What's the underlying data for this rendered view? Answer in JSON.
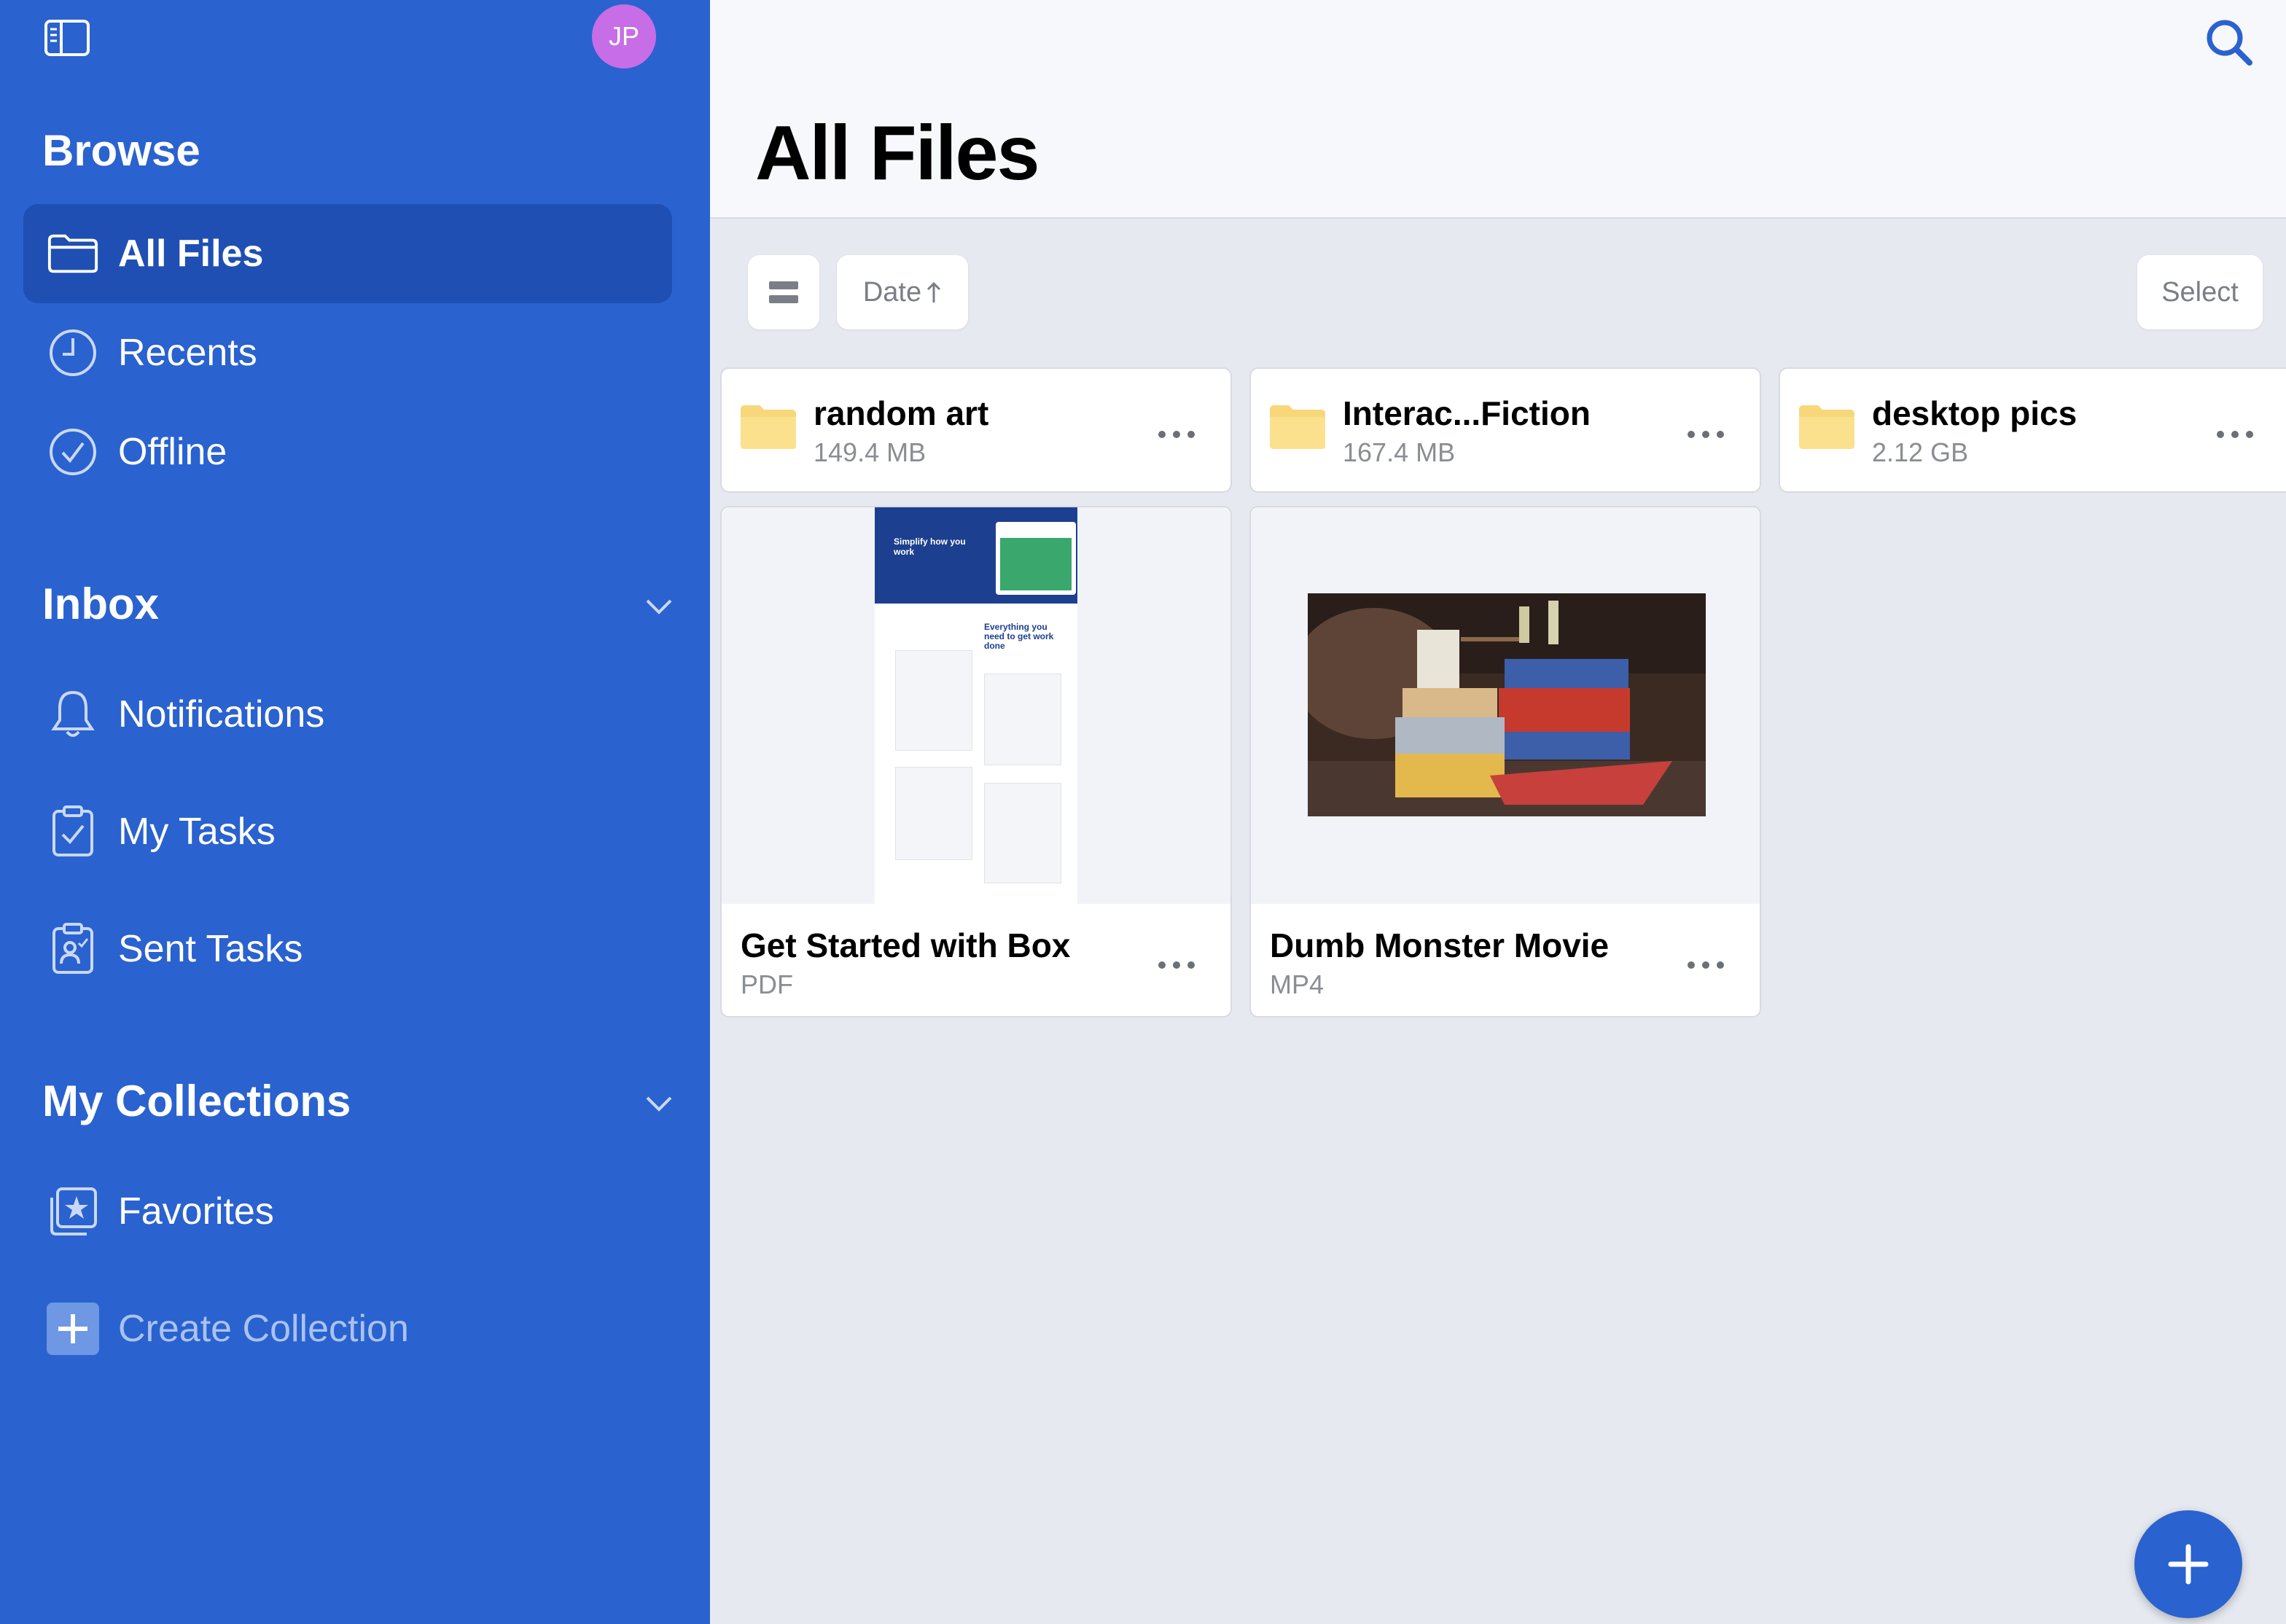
{
  "sidebar": {
    "avatar_initials": "JP",
    "browse": {
      "title": "Browse",
      "items": [
        {
          "label": "All Files",
          "icon": "folder-icon",
          "active": true
        },
        {
          "label": "Recents",
          "icon": "clock-icon"
        },
        {
          "label": "Offline",
          "icon": "check-circle-icon"
        }
      ]
    },
    "inbox": {
      "title": "Inbox",
      "items": [
        {
          "label": "Notifications",
          "icon": "bell-icon"
        },
        {
          "label": "My Tasks",
          "icon": "task-clipboard-icon"
        },
        {
          "label": "Sent Tasks",
          "icon": "sent-task-clipboard-icon"
        }
      ]
    },
    "collections": {
      "title": "My Collections",
      "items": [
        {
          "label": "Favorites",
          "icon": "star-collection-icon"
        },
        {
          "label": "Create Collection",
          "icon": "plus-square-icon"
        }
      ]
    }
  },
  "main": {
    "title": "All Files",
    "toolbar": {
      "sort_label": "Date",
      "select_label": "Select"
    },
    "folders": [
      {
        "name": "random art",
        "size": "149.4 MB"
      },
      {
        "name": "Interac...Fiction",
        "size": "167.4 MB"
      },
      {
        "name": "desktop pics",
        "size": "2.12 GB"
      }
    ],
    "files": [
      {
        "name": "Get Started with Box",
        "type": "PDF"
      },
      {
        "name": "Dumb Monster Movie",
        "type": "MP4"
      }
    ],
    "pdf_preview": {
      "headline": "Simplify how you work",
      "subhead": "Everything you need to get work done"
    }
  },
  "colors": {
    "sidebar_bg": "#2a62cf",
    "sidebar_active": "#1f4fb3",
    "avatar": "#c76de6",
    "folder": "#f8d77a",
    "accent": "#2a62cf"
  }
}
